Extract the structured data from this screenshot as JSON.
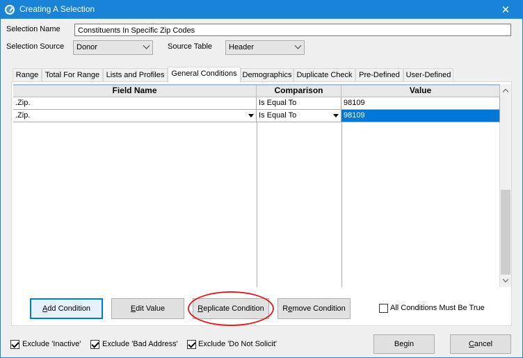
{
  "window": {
    "title": "Creating A Selection",
    "close_glyph": "✕",
    "app_icon": "app-logo-icon"
  },
  "form": {
    "selection_name_label": "Selection Name",
    "selection_name_value": "Constituents In Specific Zip Codes",
    "selection_source_label": "Selection Source",
    "selection_source_value": "Donor",
    "source_table_label": "Source Table",
    "source_table_value": "Header"
  },
  "tabs": [
    {
      "label": "Range"
    },
    {
      "label": "Total For Range"
    },
    {
      "label": "Lists and Profiles"
    },
    {
      "label": "General Conditions",
      "active": true
    },
    {
      "label": "Demographics"
    },
    {
      "label": "Duplicate Check"
    },
    {
      "label": "Pre-Defined"
    },
    {
      "label": "User-Defined"
    }
  ],
  "grid": {
    "columns": [
      "Field Name",
      "Comparison",
      "Value"
    ],
    "rows": [
      {
        "field": ".Zip.",
        "comparison": "Is Equal To",
        "value": "98109",
        "selected": false
      },
      {
        "field": ".Zip.",
        "comparison": "Is Equal To",
        "value": "98109",
        "selected": true
      }
    ]
  },
  "buttons": {
    "add_condition_prefix": "A",
    "add_condition_rest": "dd Condition",
    "edit_value_prefix": "E",
    "edit_value_rest": "dit Value",
    "replicate_condition_prefix": "R",
    "replicate_condition_rest": "eplicate Condition",
    "remove_condition_pre": "R",
    "remove_condition_ul": "e",
    "remove_condition_rest": "move Condition",
    "all_conditions_label": "All Conditions Must Be True",
    "begin": "Begin",
    "cancel_prefix": "C",
    "cancel_rest": "ancel"
  },
  "checks": {
    "all_conditions_checked": false,
    "exclude_inactive_label": "Exclude 'Inactive'",
    "exclude_inactive_checked": true,
    "exclude_bad_address_label": "Exclude 'Bad Address'",
    "exclude_bad_address_checked": true,
    "exclude_do_not_solicit_label": "Exclude 'Do Not Solicit'",
    "exclude_do_not_solicit_checked": true
  },
  "colors": {
    "accent": "#1883d7",
    "selection": "#0078d7",
    "highlight": "#e02020"
  }
}
